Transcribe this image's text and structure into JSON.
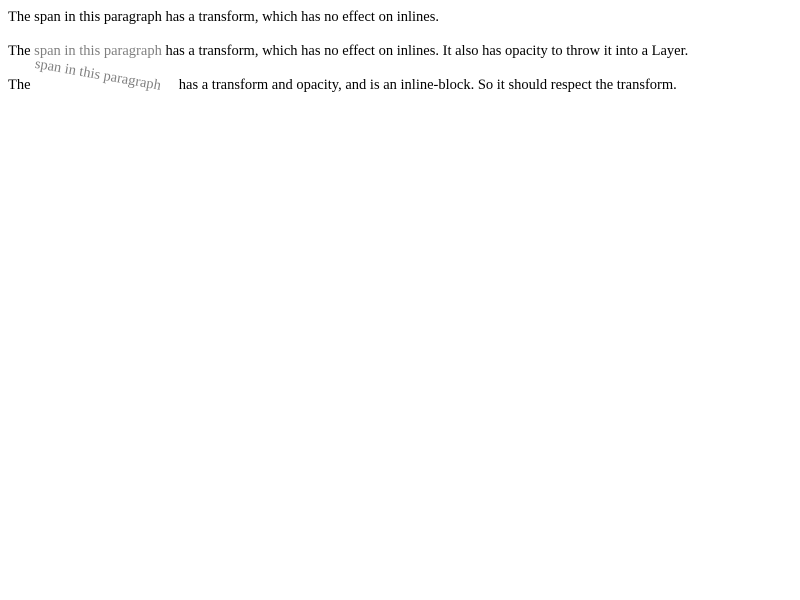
{
  "paragraphs": [
    {
      "prefix": "The ",
      "span": "span in this paragraph",
      "suffix": " has a transform, which has no effect on inlines."
    },
    {
      "prefix": "The ",
      "span": "span in this paragraph",
      "suffix": " has a transform, which has no effect on inlines. It also has opacity to throw it into a Layer."
    },
    {
      "prefix": "The ",
      "span": "span in this paragraph",
      "suffix": " has a transform and opacity, and is an inline-block. So it should respect the transform."
    }
  ]
}
